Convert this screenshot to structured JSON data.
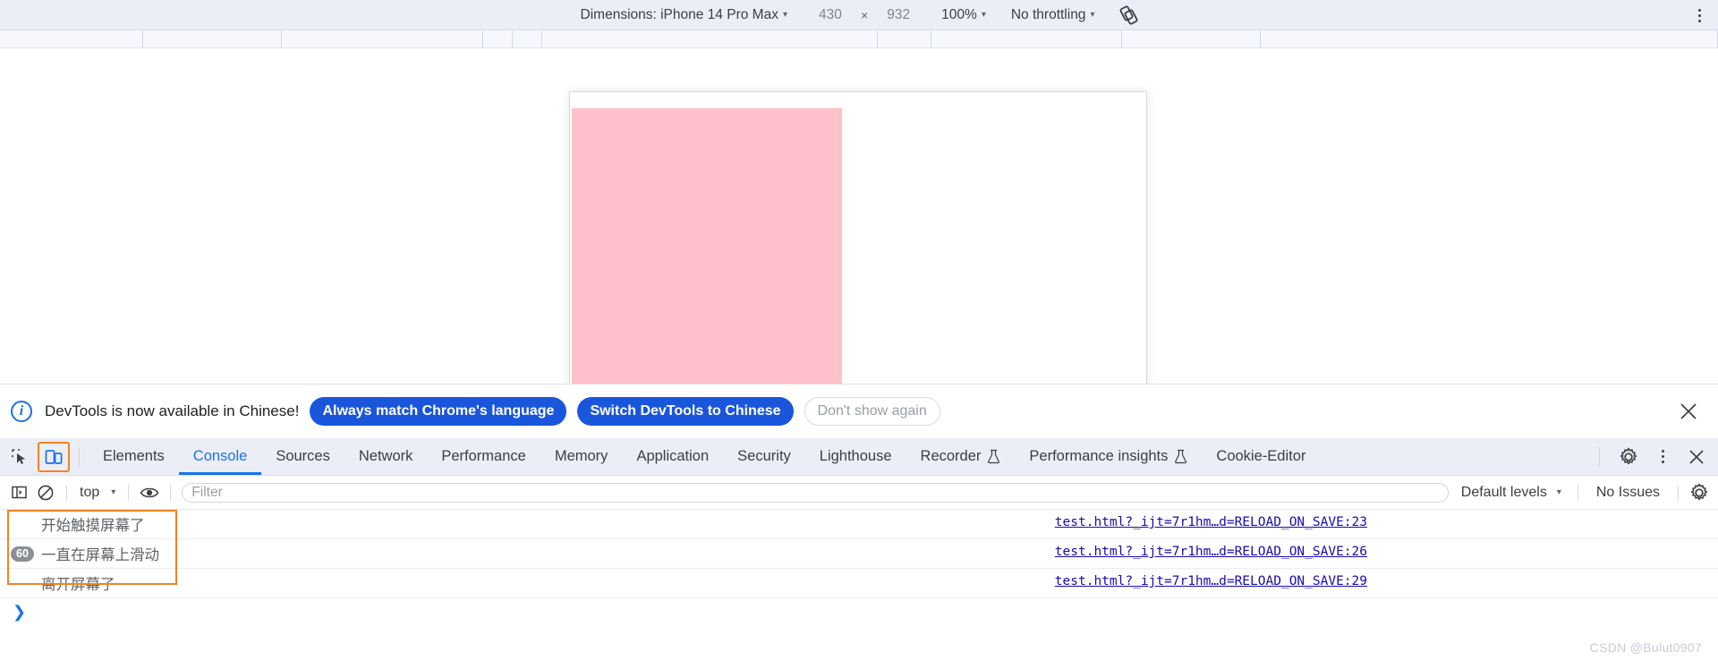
{
  "device_toolbar": {
    "dimensions_label": "Dimensions: iPhone 14 Pro Max",
    "width_value": "430",
    "times": "×",
    "height_value": "932",
    "zoom_value": "100%",
    "throttling_value": "No throttling",
    "rotate_icon": "rotate-device-icon",
    "more_options_icon": "kebab-menu-icon",
    "caret": "▾"
  },
  "viewport": {
    "pink_box_color": "#ffc0cb",
    "frame_background": "#ffffff"
  },
  "banner": {
    "info_icon": "info-icon",
    "message": "DevTools is now available in Chinese!",
    "primary_button": "Always match Chrome's language",
    "secondary_button": "Switch DevTools to Chinese",
    "dismiss_button": "Don't show again",
    "close_icon": "close-icon",
    "primary_color": "#1a56db"
  },
  "tabstrip": {
    "inspect_icon": "inspect-element-icon",
    "device_toggle_icon": "toggle-device-toolbar-icon",
    "device_toggle_highlight_color": "#f28321",
    "tabs": [
      {
        "label": "Elements",
        "active": false,
        "experiment": false
      },
      {
        "label": "Console",
        "active": true,
        "experiment": false
      },
      {
        "label": "Sources",
        "active": false,
        "experiment": false
      },
      {
        "label": "Network",
        "active": false,
        "experiment": false
      },
      {
        "label": "Performance",
        "active": false,
        "experiment": false
      },
      {
        "label": "Memory",
        "active": false,
        "experiment": false
      },
      {
        "label": "Application",
        "active": false,
        "experiment": false
      },
      {
        "label": "Security",
        "active": false,
        "experiment": false
      },
      {
        "label": "Lighthouse",
        "active": false,
        "experiment": false
      },
      {
        "label": "Recorder",
        "active": false,
        "experiment": true
      },
      {
        "label": "Performance insights",
        "active": false,
        "experiment": true
      },
      {
        "label": "Cookie-Editor",
        "active": false,
        "experiment": false
      }
    ],
    "settings_icon": "gear-icon",
    "more_icon": "kebab-menu-icon",
    "close_icon": "close-icon"
  },
  "filterbar": {
    "sidebar_icon": "console-sidebar-icon",
    "clear_icon": "clear-console-icon",
    "context_value": "top",
    "eye_icon": "live-expression-icon",
    "filter_placeholder": "Filter",
    "filter_value": "",
    "levels_value": "Default levels",
    "issues_value": "No Issues",
    "settings_icon": "gear-icon",
    "caret": "▾"
  },
  "console": {
    "highlight_color": "#f28321",
    "messages": [
      {
        "badge": "",
        "text": "开始触摸屏幕了",
        "source": "test.html?_ijt=7r1hm…d=RELOAD_ON_SAVE:23"
      },
      {
        "badge": "60",
        "text": "一直在屏幕上滑动",
        "source": "test.html?_ijt=7r1hm…d=RELOAD_ON_SAVE:26"
      },
      {
        "badge": "",
        "text": "离开屏幕了",
        "source": "test.html?_ijt=7r1hm…d=RELOAD_ON_SAVE:29"
      }
    ],
    "prompt_caret": "❯"
  },
  "watermark": "CSDN @Bulut0907"
}
